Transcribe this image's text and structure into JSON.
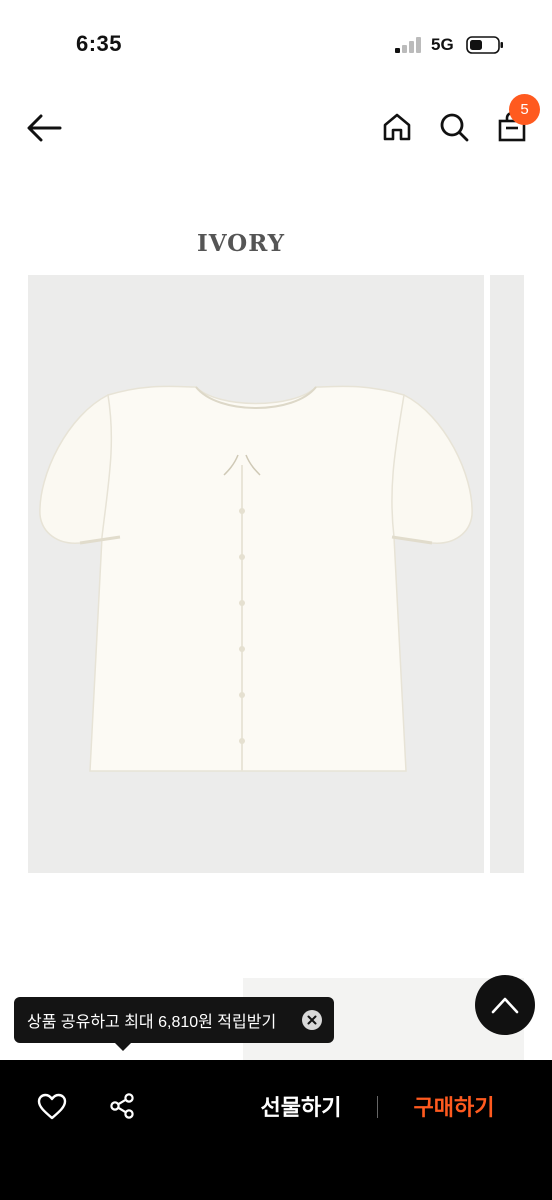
{
  "status_bar": {
    "time": "6:35",
    "network": "5G"
  },
  "header": {
    "cart_count": "5"
  },
  "product": {
    "color_label": "IVORY"
  },
  "tooltip": {
    "text": "상품 공유하고 최대 6,810원 적립받기"
  },
  "bottom_bar": {
    "gift_label": "선물하기",
    "buy_label": "구매하기"
  },
  "colors": {
    "accent": "#ff5a1f",
    "dark": "#000000",
    "photo_bg": "#ececeb"
  }
}
